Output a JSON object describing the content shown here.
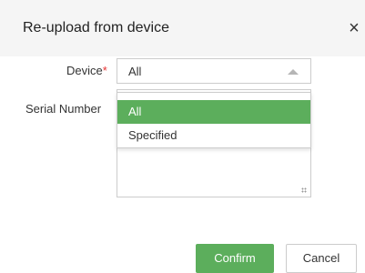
{
  "dialog": {
    "title": "Re-upload from device",
    "close_label": "×"
  },
  "form": {
    "device_label": "Device",
    "required_mark": "*",
    "device_value": "All",
    "serial_label": "Serial Number"
  },
  "dropdown": {
    "options": [
      "All",
      "Specified"
    ],
    "selected": "All"
  },
  "buttons": {
    "confirm": "Confirm",
    "cancel": "Cancel"
  },
  "colors": {
    "accent": "#5cae5c",
    "required": "#e63232"
  }
}
